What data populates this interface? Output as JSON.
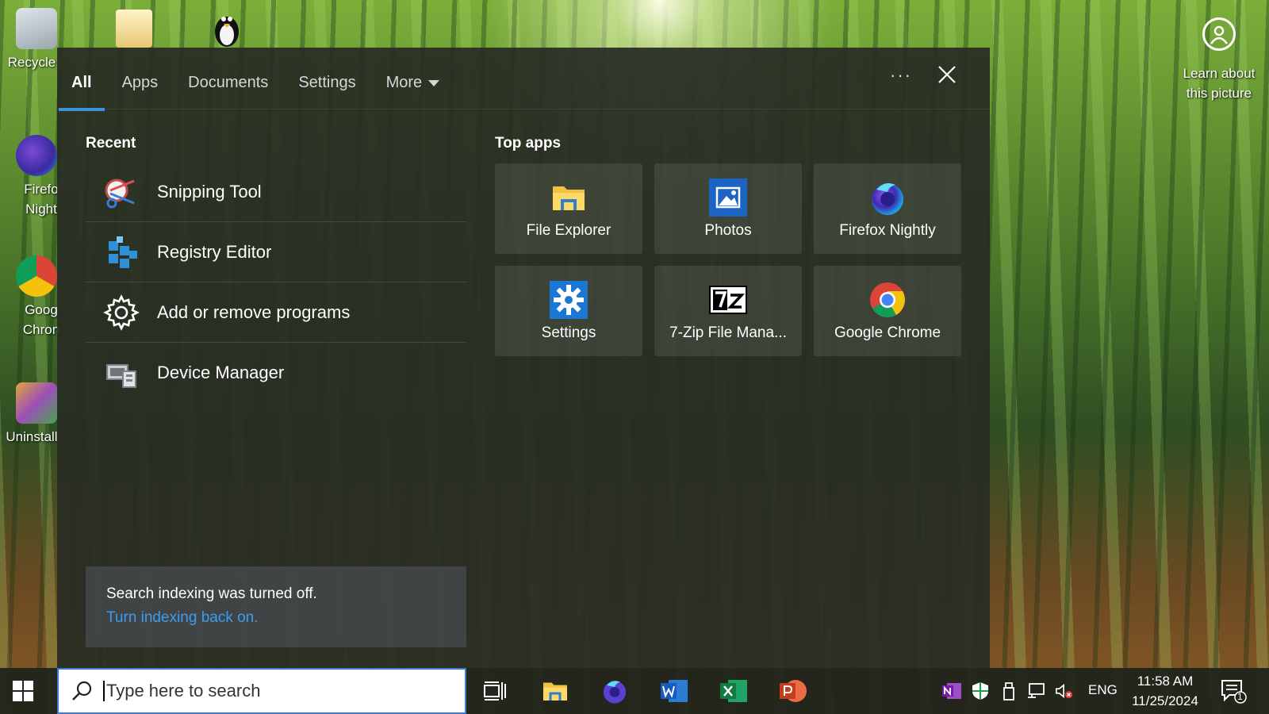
{
  "desktop": {
    "icons": [
      {
        "label": "Recycle"
      },
      {
        "label": "Firefo Night"
      },
      {
        "label": "Goog Chron"
      },
      {
        "label": "Uninstall"
      }
    ],
    "learn_label": "Learn about this picture"
  },
  "search_panel": {
    "tabs": [
      {
        "label": "All"
      },
      {
        "label": "Apps"
      },
      {
        "label": "Documents"
      },
      {
        "label": "Settings"
      },
      {
        "label": "More"
      }
    ],
    "more_options": "···",
    "recent_title": "Recent",
    "recent": [
      {
        "label": "Snipping Tool",
        "icon": "snipping-tool-icon"
      },
      {
        "label": "Registry Editor",
        "icon": "registry-editor-icon"
      },
      {
        "label": "Add or remove programs",
        "icon": "gear-icon"
      },
      {
        "label": "Device Manager",
        "icon": "device-manager-icon"
      }
    ],
    "top_apps_title": "Top apps",
    "top_apps": [
      {
        "label": "File Explorer",
        "icon": "file-explorer-icon"
      },
      {
        "label": "Photos",
        "icon": "photos-icon"
      },
      {
        "label": "Firefox Nightly",
        "icon": "firefox-nightly-icon"
      },
      {
        "label": "Settings",
        "icon": "settings-gear-icon"
      },
      {
        "label": "7-Zip File Mana...",
        "icon": "7zip-icon"
      },
      {
        "label": "Google Chrome",
        "icon": "chrome-icon"
      }
    ],
    "notice": {
      "message": "Search indexing was turned off.",
      "link": "Turn indexing back on."
    }
  },
  "taskbar": {
    "search_placeholder": "Type here to search",
    "pinned": [
      "task-view-icon",
      "file-explorer-icon",
      "firefox-icon",
      "word-icon",
      "excel-icon",
      "powerpoint-icon"
    ],
    "tray": {
      "language": "ENG",
      "time": "11:58 AM",
      "date": "11/25/2024",
      "notification_count": "1"
    }
  },
  "colors": {
    "accent": "#3a8fd8",
    "link": "#3d9cf0"
  }
}
